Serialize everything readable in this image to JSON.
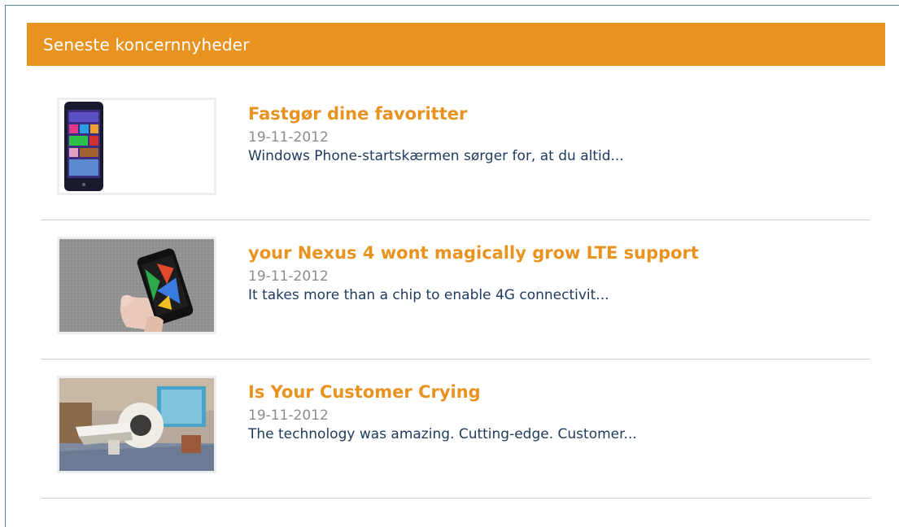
{
  "widget": {
    "title": "Seneste koncernnyheder",
    "accent_color": "#e8921f",
    "title_color": "#e8921f",
    "date_color": "#8c8c8c",
    "excerpt_color": "#1e3a5c"
  },
  "news": [
    {
      "title": "Fastgør dine favoritter",
      "date": "19-11-2012",
      "excerpt": "Windows Phone-startskærmen sørger for, at du altid...",
      "thumbnail": "windows-phone-thumbnail"
    },
    {
      "title": "your Nexus 4 wont magically grow LTE support",
      "date": "19-11-2012",
      "excerpt": "It takes more than a chip to enable 4G connectivit...",
      "thumbnail": "nexus-phone-in-hand-thumbnail"
    },
    {
      "title": "Is Your Customer Crying",
      "date": "19-11-2012",
      "excerpt": "The technology was amazing. Cutting-edge. Customer...",
      "thumbnail": "mri-scanner-room-thumbnail"
    }
  ]
}
